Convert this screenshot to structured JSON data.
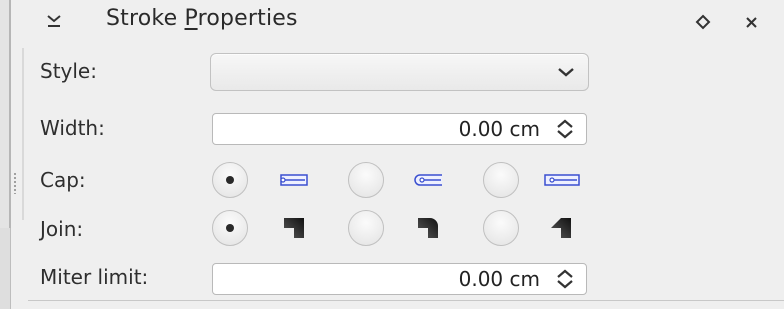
{
  "panel": {
    "title_pre": "Stroke ",
    "title_underlined": "P",
    "title_post": "roperties"
  },
  "style": {
    "label": "Style:",
    "value": ""
  },
  "width": {
    "label": "Width:",
    "value": "0.00 cm"
  },
  "cap": {
    "label": "Cap:",
    "options": [
      {
        "icon": "cap-butt-icon",
        "selected": true
      },
      {
        "icon": "cap-round-icon",
        "selected": false
      },
      {
        "icon": "cap-square-icon",
        "selected": false
      }
    ]
  },
  "join": {
    "label": "Join:",
    "options": [
      {
        "icon": "join-miter-icon",
        "selected": true
      },
      {
        "icon": "join-round-icon",
        "selected": false
      },
      {
        "icon": "join-bevel-icon",
        "selected": false
      }
    ]
  },
  "miter_limit": {
    "label": "Miter limit:",
    "value": "0.00 cm"
  },
  "colors": {
    "background": "#efefef",
    "cap_icon_blue": "#3a4fd0",
    "join_icon": "#1e1e1e"
  }
}
